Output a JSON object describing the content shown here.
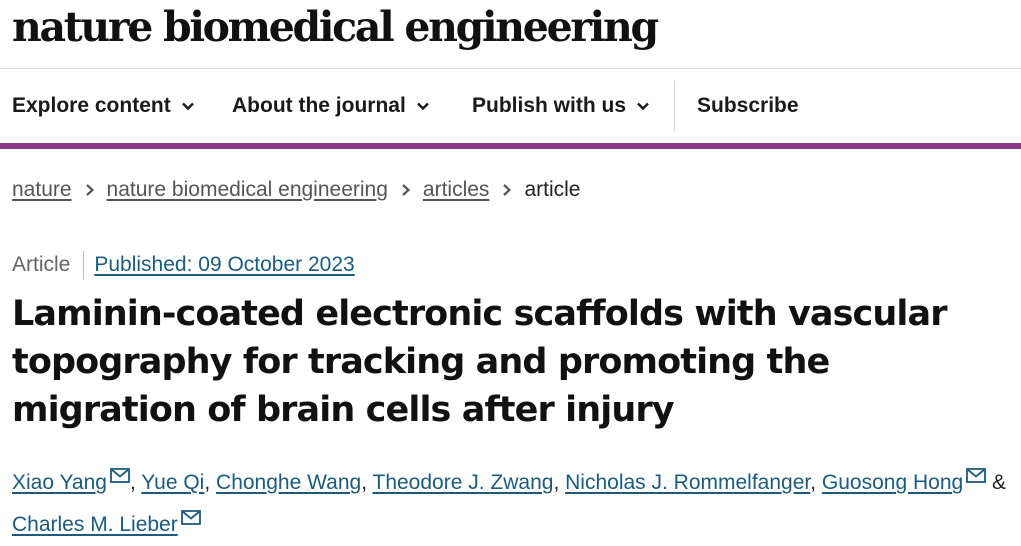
{
  "header": {
    "logo": "nature biomedical engineering"
  },
  "nav": {
    "explore": "Explore content",
    "about": "About the journal",
    "publish": "Publish with us",
    "subscribe": "Subscribe"
  },
  "breadcrumb": {
    "items": [
      "nature",
      "nature biomedical engineering",
      "articles"
    ],
    "current": "article"
  },
  "article": {
    "type": "Article",
    "published": "Published: 09 October 2023",
    "title": "Laminin-coated electronic scaffolds with vascular topography for tracking and promoting the migration of brain cells after injury",
    "authors": [
      "Xiao Yang",
      "Yue Qi",
      "Chonghe Wang",
      "Theodore J. Zwang",
      "Nicholas J. Rommelfanger",
      "Guosong Hong",
      "Charles M. Lieber"
    ],
    "author_separator": ",",
    "author_conjunction": "&"
  },
  "icons": {
    "nav_chevron": "chevron-down-icon",
    "breadcrumb_separator": "chevron-right-icon",
    "author_email": "mail-icon"
  },
  "colors": {
    "accent_bar": "#8b3a88",
    "link": "#1c5b7d"
  }
}
